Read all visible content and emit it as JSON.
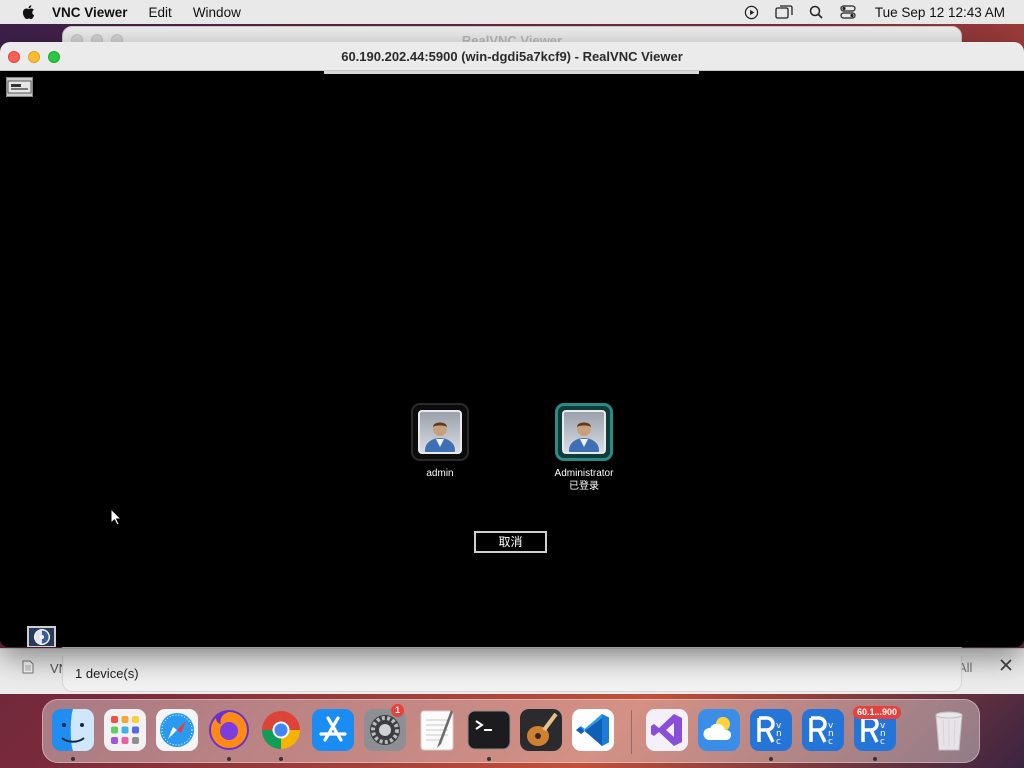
{
  "menubar": {
    "app_name": "VNC Viewer",
    "menus": [
      "Edit",
      "Window"
    ],
    "clock": "Tue Sep 12  12:43 AM",
    "status_icons": [
      "screen-record-icon",
      "window-switch-icon",
      "spotlight-search-icon",
      "control-center-icon"
    ]
  },
  "background_window": {
    "title": "RealVNC Viewer"
  },
  "vnc_window": {
    "title": "60.190.202.44:5900 (win-dgdi5a7kcf9) - RealVNC Viewer"
  },
  "remote_login": {
    "users": [
      {
        "name": "admin",
        "status": ""
      },
      {
        "name": "Administrator",
        "status": "已登录"
      }
    ],
    "cancel_label": "取消"
  },
  "address_book": {
    "left_label": "VN",
    "right_label": "All",
    "device_count": "1 device(s)"
  },
  "dock": {
    "apps": [
      {
        "name": "Finder",
        "icon": "finder-icon",
        "running": true
      },
      {
        "name": "Launchpad",
        "icon": "launchpad-icon",
        "running": false
      },
      {
        "name": "Safari",
        "icon": "safari-icon",
        "running": false
      },
      {
        "name": "Firefox",
        "icon": "firefox-icon",
        "running": true
      },
      {
        "name": "Google Chrome",
        "icon": "chrome-icon",
        "running": true
      },
      {
        "name": "App Store",
        "icon": "app-store-icon",
        "running": false
      },
      {
        "name": "System Settings",
        "icon": "settings-icon",
        "running": false,
        "badge": "1"
      },
      {
        "name": "TextEdit",
        "icon": "textedit-icon",
        "running": false
      },
      {
        "name": "Terminal",
        "icon": "terminal-icon",
        "running": true
      },
      {
        "name": "Instruments",
        "icon": "instruments-icon",
        "running": false
      },
      {
        "name": "Visual Studio Code",
        "icon": "vscode-icon",
        "running": false
      },
      {
        "name": "Visual Studio",
        "icon": "visual-studio-icon",
        "running": false
      },
      {
        "name": "Weather",
        "icon": "weather-icon",
        "running": false
      },
      {
        "name": "VNC Viewer",
        "icon": "vnc-viewer-icon",
        "running": true
      },
      {
        "name": "VNC Viewer",
        "icon": "vnc-viewer-icon",
        "running": false
      },
      {
        "name": "VNC Viewer",
        "icon": "vnc-viewer-icon",
        "running": true,
        "badge": "60.1...900"
      },
      {
        "name": "Trash",
        "icon": "trash-icon",
        "running": false
      }
    ]
  },
  "colors": {
    "selected_user_border": "#2d8a87",
    "remote_background": "#000000",
    "traffic_red": "#fe5f57",
    "traffic_yellow": "#febc2e",
    "traffic_green": "#28c840",
    "badge_red": "#e8413c"
  }
}
